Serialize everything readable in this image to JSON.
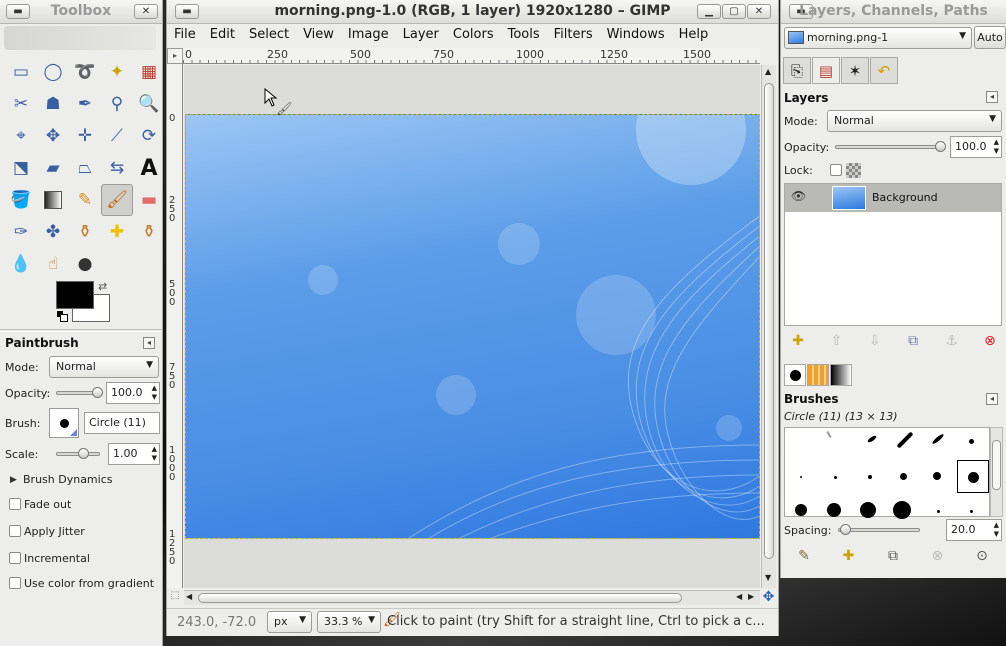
{
  "toolbox": {
    "title": "Toolbox",
    "tool_icons": [
      "rect-select-icon",
      "ellipse-select-icon",
      "free-select-icon",
      "fuzzy-select-icon",
      "select-by-color-icon",
      "scissors-icon",
      "foreground-select-icon",
      "paths-icon",
      "color-picker-icon",
      "zoom-icon",
      "measure-icon",
      "move-icon",
      "align-icon",
      "crop-icon",
      "rotate-icon",
      "scale-icon",
      "shear-icon",
      "perspective-icon",
      "flip-icon",
      "text-icon",
      "bucket-fill-icon",
      "blend-icon",
      "pencil-icon",
      "paintbrush-icon",
      "eraser-icon",
      "airbrush-icon",
      "ink-icon",
      "clone-icon",
      "heal-icon",
      "perspective-clone-icon",
      "blur-icon",
      "smudge-icon",
      "dodge-burn-icon"
    ],
    "foreground_color": "#000000",
    "background_color": "#ffffff"
  },
  "tool_options": {
    "title": "Paintbrush",
    "mode_label": "Mode:",
    "mode_value": "Normal",
    "opacity_label": "Opacity:",
    "opacity_value": "100.0",
    "brush_label": "Brush:",
    "brush_value": "Circle (11)",
    "scale_label": "Scale:",
    "scale_value": "1.00",
    "dynamics_label": "Brush Dynamics",
    "fade_out_label": "Fade out",
    "apply_jitter_label": "Apply Jitter",
    "incremental_label": "Incremental",
    "use_color_label": "Use color from gradient"
  },
  "image_window": {
    "title": "morning.png-1.0 (RGB, 1 layer) 1920x1280 – GIMP",
    "menu": [
      "File",
      "Edit",
      "Select",
      "View",
      "Image",
      "Layer",
      "Colors",
      "Tools",
      "Filters",
      "Windows",
      "Help"
    ],
    "ruler_h_labels": [
      "0",
      "250",
      "500",
      "750",
      "1000",
      "1250",
      "1500"
    ],
    "ruler_v_labels": [
      "0",
      "250",
      "500",
      "750",
      "1000",
      "1250"
    ],
    "coords": "243.0, -72.0",
    "unit": "px",
    "zoom": "33.3 %",
    "status_message": "Click to paint (try Shift for a straight line, Ctrl to pick a c..."
  },
  "dock": {
    "title": "Layers, Channels, Paths",
    "image_combo": "morning.png-1",
    "auto_label": "Auto",
    "layers_title": "Layers",
    "mode_label": "Mode:",
    "mode_value": "Normal",
    "opacity_label": "Opacity:",
    "opacity_value": "100.0",
    "lock_label": "Lock:",
    "layer_name": "Background",
    "brushes_title": "Brushes",
    "brush_info": "Circle (11) (13 × 13)",
    "spacing_label": "Spacing:",
    "spacing_value": "20.0"
  }
}
